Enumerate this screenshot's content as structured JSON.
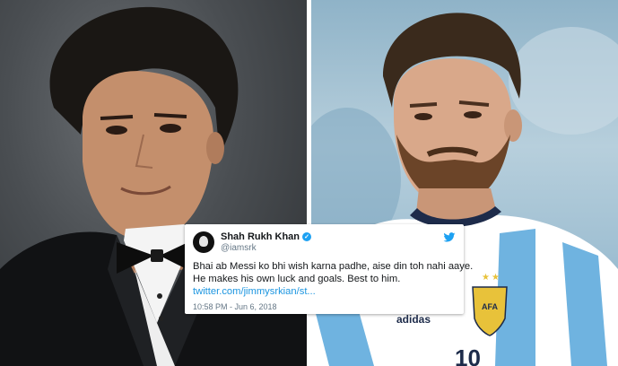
{
  "tweet": {
    "name": "Shah Rukh Khan",
    "handle": "@iamsrk",
    "text_line1": "Bhai ab Messi ko bhi wish karna padhe, aise din toh nahi aaye.",
    "text_line2": "He makes his own luck and goals. Best to him.",
    "link": "twitter.com/jimmysrkian/st...",
    "timestamp": "10:58 PM - Jun 6, 2018"
  },
  "jersey": {
    "sponsor": "adidas",
    "crest": "AFA",
    "number": "10"
  },
  "colors": {
    "twitter_blue": "#1da1f2",
    "link_blue": "#1b95e0",
    "jersey_blue": "#6fb3e0"
  },
  "icons": [
    "twitter-bird-icon",
    "verified-badge-icon",
    "avatar"
  ]
}
